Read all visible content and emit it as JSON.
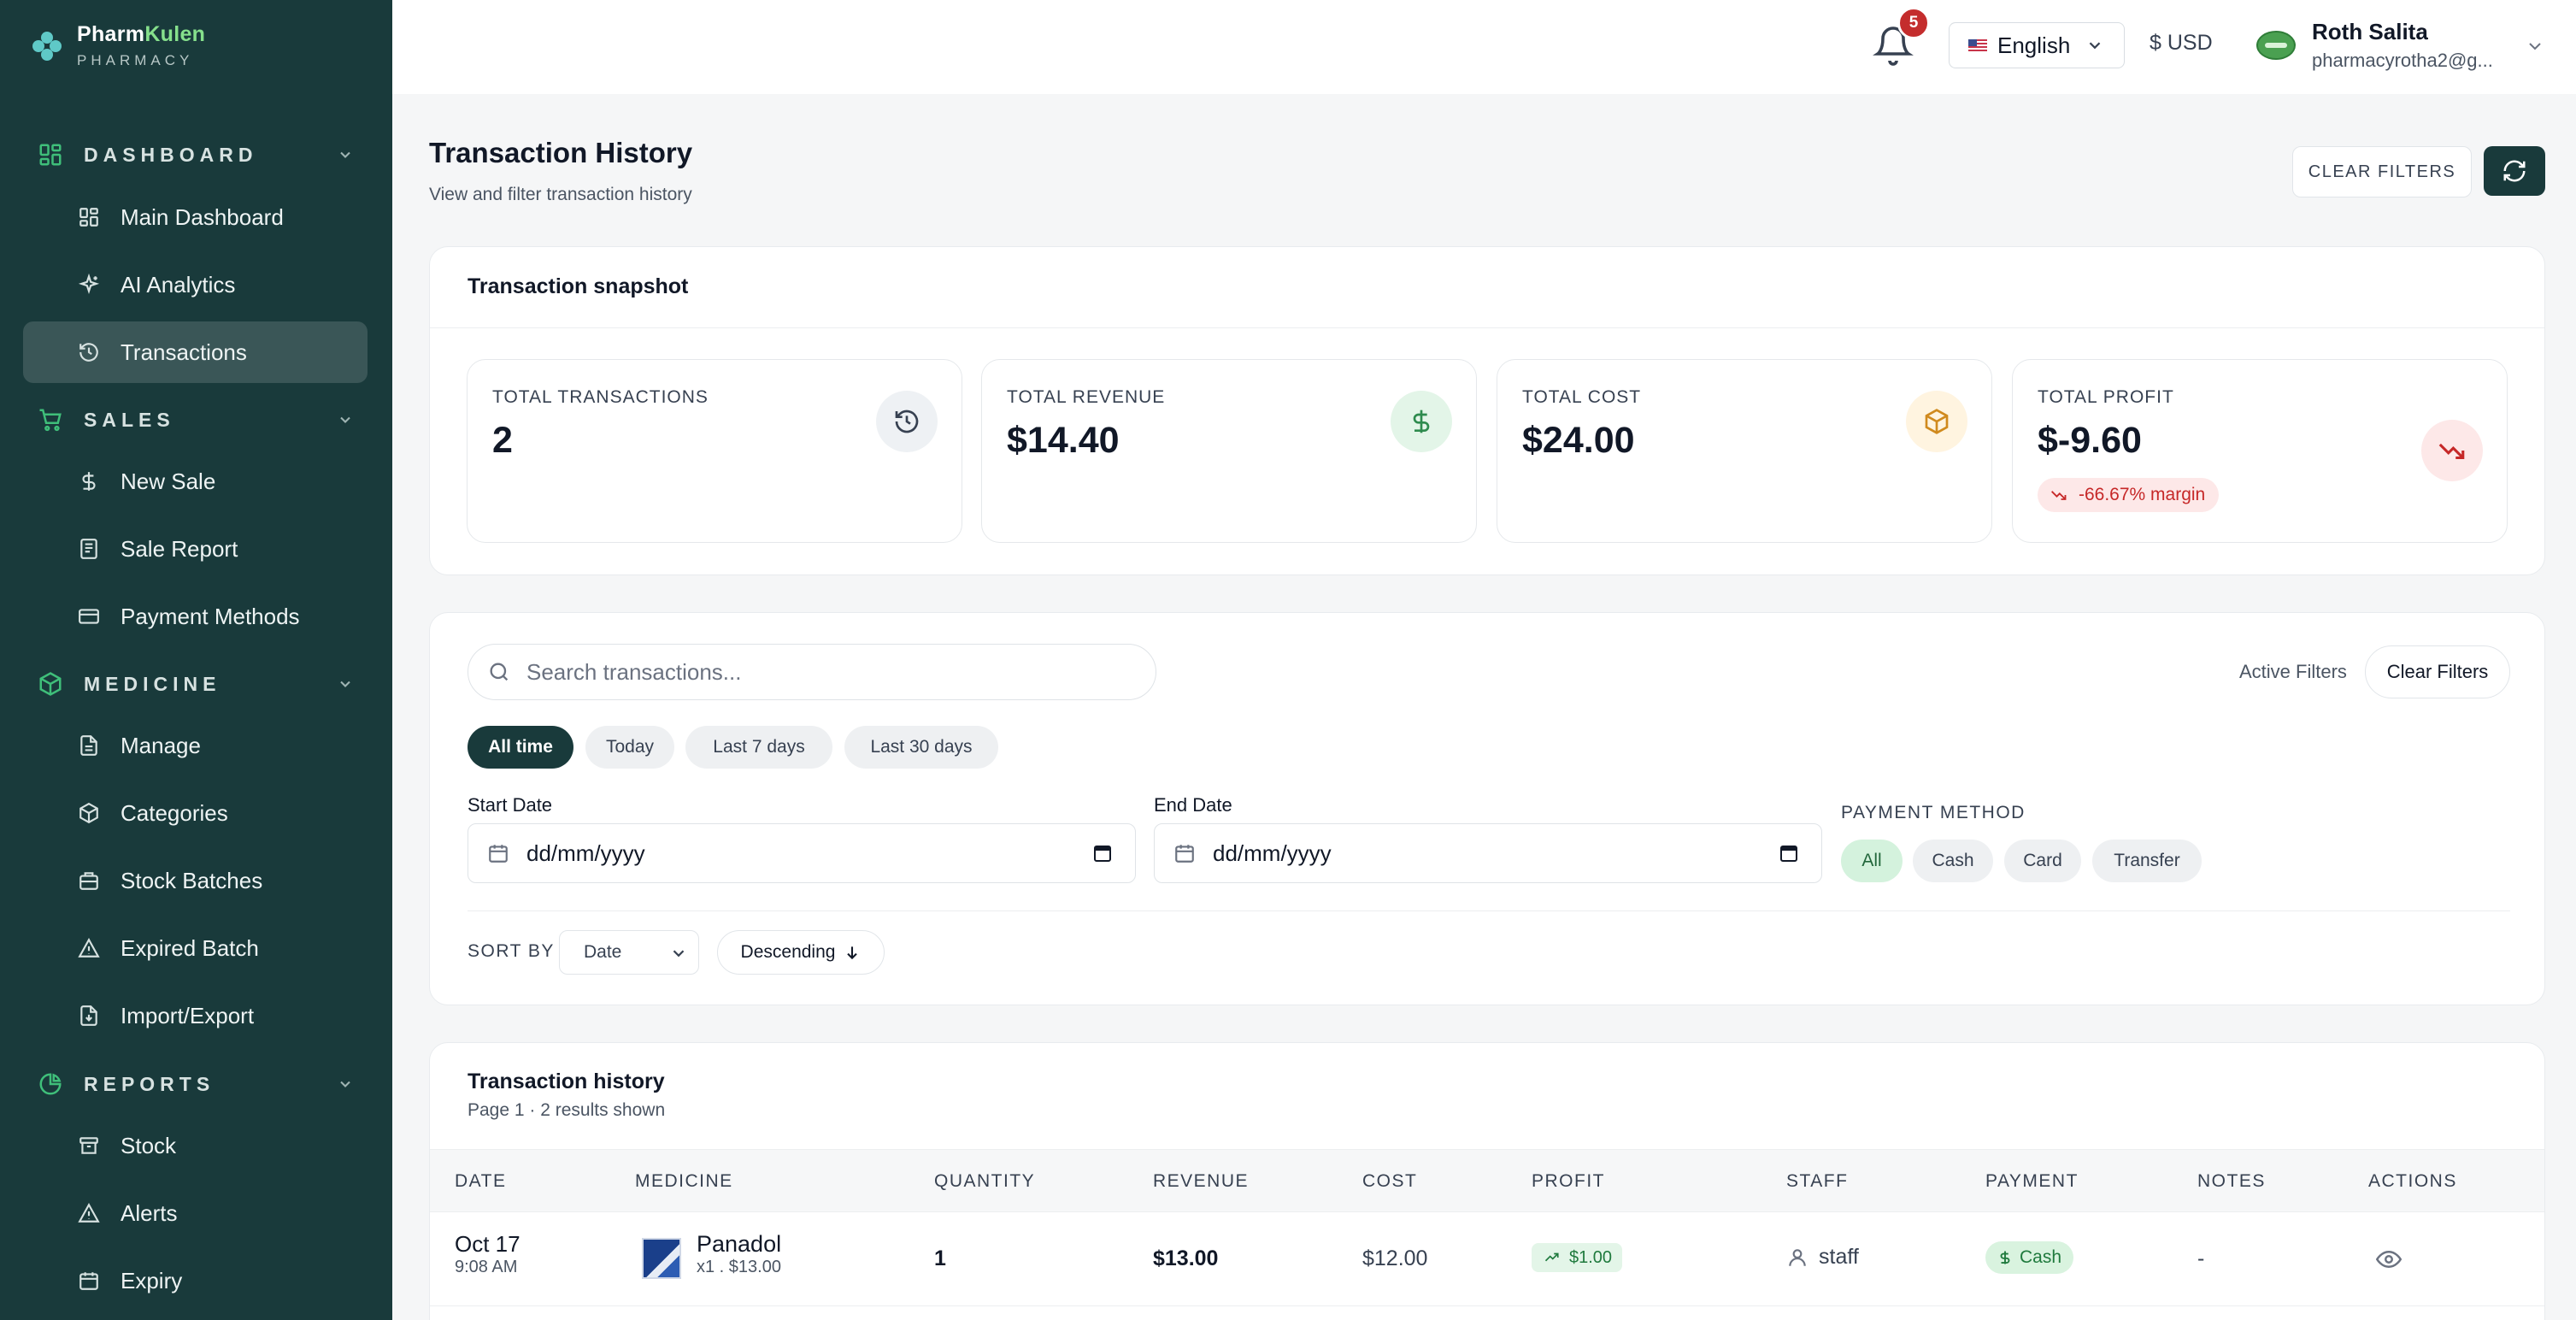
{
  "brand": {
    "name_part1": "Pharm",
    "name_part2": "Kulen",
    "subtitle": "PHARMACY"
  },
  "sidebar": {
    "sections": [
      {
        "label": "DASHBOARD",
        "icon": "grid-icon",
        "items": [
          {
            "label": "Main Dashboard",
            "icon": "grid-icon"
          },
          {
            "label": "AI Analytics",
            "icon": "sparkle-icon"
          },
          {
            "label": "Transactions",
            "icon": "history-icon",
            "active": true
          }
        ]
      },
      {
        "label": "SALES",
        "icon": "cart-icon",
        "items": [
          {
            "label": "New Sale",
            "icon": "dollar-icon"
          },
          {
            "label": "Sale Report",
            "icon": "receipt-icon"
          },
          {
            "label": "Payment Methods",
            "icon": "credit-card-icon"
          }
        ]
      },
      {
        "label": "MEDICINE",
        "icon": "package-icon",
        "items": [
          {
            "label": "Manage",
            "icon": "document-icon"
          },
          {
            "label": "Categories",
            "icon": "package-icon"
          },
          {
            "label": "Stock Batches",
            "icon": "briefcase-icon"
          },
          {
            "label": "Expired Batch",
            "icon": "warning-icon"
          },
          {
            "label": "Import/Export",
            "icon": "file-import-icon"
          }
        ]
      },
      {
        "label": "REPORTS",
        "icon": "pie-chart-icon",
        "items": [
          {
            "label": "Stock",
            "icon": "archive-icon"
          },
          {
            "label": "Alerts",
            "icon": "warning-icon"
          },
          {
            "label": "Expiry",
            "icon": "calendar-icon"
          }
        ]
      }
    ]
  },
  "header": {
    "notifications_count": "5",
    "language": "English",
    "currency": "$ USD",
    "user_name": "Roth Salita",
    "user_email": "pharmacyrotha2@g..."
  },
  "page": {
    "title": "Transaction History",
    "subtitle": "View and filter transaction history",
    "clear_filters_label": "CLEAR FILTERS"
  },
  "snapshot": {
    "title": "Transaction snapshot",
    "stats": [
      {
        "label": "TOTAL TRANSACTIONS",
        "value": "2",
        "icon": "history-icon"
      },
      {
        "label": "TOTAL REVENUE",
        "value": "$14.40",
        "icon": "dollar-icon"
      },
      {
        "label": "TOTAL COST",
        "value": "$24.00",
        "icon": "package-icon"
      },
      {
        "label": "TOTAL PROFIT",
        "value": "$-9.60",
        "icon": "trending-down-icon",
        "margin": "-66.67% margin"
      }
    ]
  },
  "filters": {
    "search_placeholder": "Search transactions...",
    "active_filters_label": "Active Filters",
    "clear_filters_label": "Clear Filters",
    "ranges": [
      "All time",
      "Today",
      "Last 7 days",
      "Last 30 days"
    ],
    "selected_range": "All time",
    "start_date_label": "Start Date",
    "end_date_label": "End Date",
    "date_placeholder": "dd/mm/yyyy",
    "payment_method_label": "PAYMENT METHOD",
    "payment_methods": [
      "All",
      "Cash",
      "Card",
      "Transfer"
    ],
    "selected_payment": "All",
    "sort_by_label": "SORT BY",
    "sort_field": "Date",
    "sort_direction": "Descending"
  },
  "history": {
    "title": "Transaction history",
    "subtitle": "Page 1 · 2 results shown",
    "columns": [
      "DATE",
      "MEDICINE",
      "QUANTITY",
      "REVENUE",
      "COST",
      "PROFIT",
      "STAFF",
      "PAYMENT",
      "NOTES",
      "ACTIONS"
    ],
    "rows": [
      {
        "date": "Oct 17",
        "time": "9:08 AM",
        "medicine": "Panadol",
        "medicine_sub": "x1 . $13.00",
        "quantity": "1",
        "revenue": "$13.00",
        "cost": "$12.00",
        "profit": "$1.00",
        "staff": "staff",
        "payment": "Cash",
        "notes": "-"
      }
    ]
  },
  "colors": {
    "sidebar_bg": "#193a3b",
    "accent_green": "#86e08c",
    "badge_red": "#c42d2d",
    "profit_negative": "#c62828",
    "profit_positive": "#1f7a3d"
  }
}
